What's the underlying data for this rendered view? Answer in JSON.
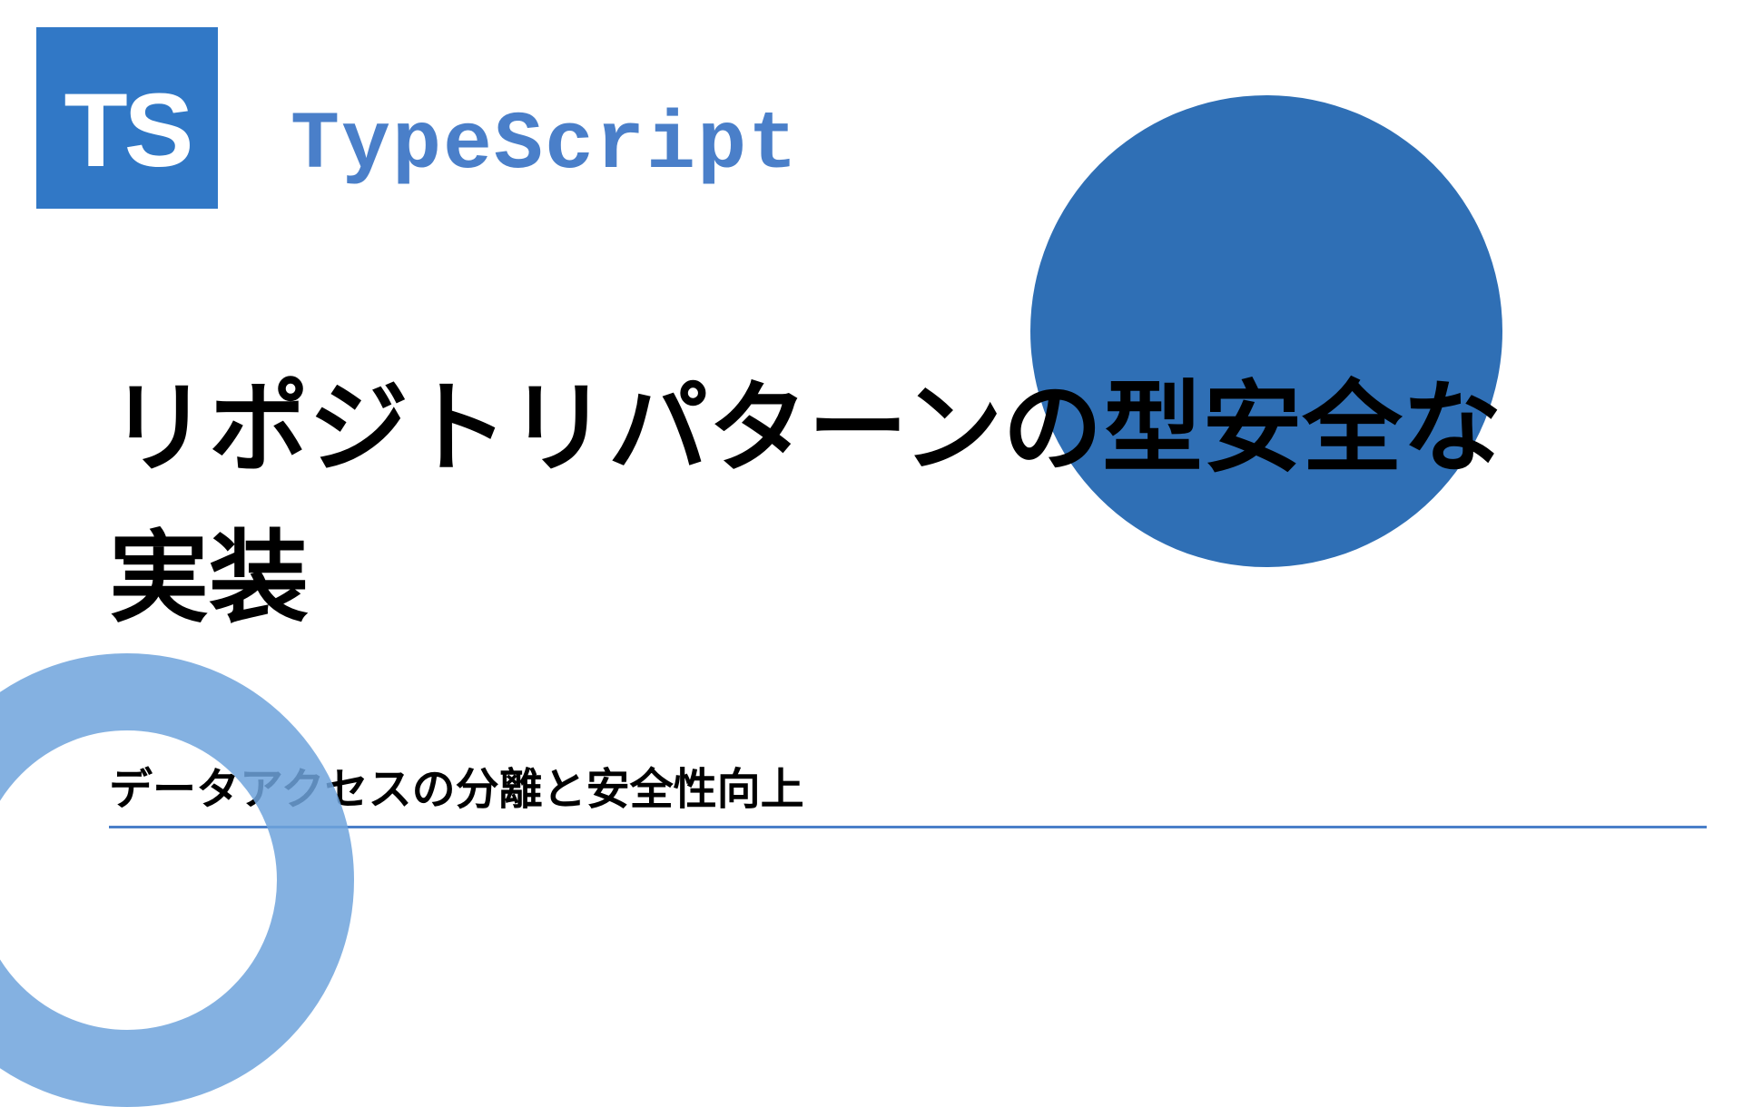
{
  "logo": {
    "text": "TS"
  },
  "brand": "TypeScript",
  "title": "リポジトリパターンの型安全な実装",
  "subtitle": "データアクセスの分離と安全性向上",
  "colors": {
    "primary": "#3178c6",
    "accent": "#4a7fc9",
    "circle": "#2f6fb5",
    "ring": "#6fa3dc"
  }
}
